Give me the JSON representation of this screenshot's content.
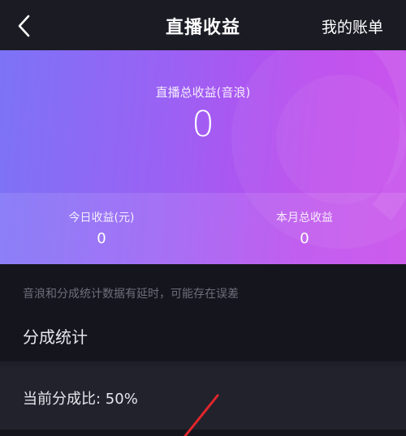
{
  "header": {
    "title": "直播收益",
    "right_link": "我的账单",
    "back_icon": "chevron-left-icon"
  },
  "earnings": {
    "total_label": "直播总收益(音浪)",
    "total_value": "0",
    "today_label": "今日收益(元)",
    "today_value": "0",
    "month_label": "本月总收益",
    "month_value": "0"
  },
  "notice": "音浪和分成统计数据有延时，可能存在误差",
  "share_section": {
    "title": "分成统计",
    "ratio_text": "当前分成比: 50%"
  },
  "colors": {
    "gradient_start": "#7c73f6",
    "gradient_end": "#c84aea",
    "annotation": "#e0262b",
    "background": "#15151d"
  }
}
